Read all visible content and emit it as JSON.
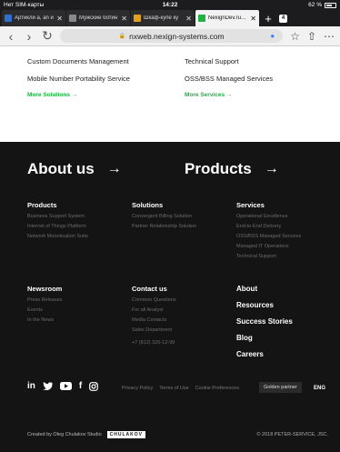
{
  "status": {
    "carrier": "Нет SIM-карты",
    "time": "14:22",
    "battery": "62 %",
    "battery_level": 0.62
  },
  "tabs": [
    {
      "label": "Артикли а, an и",
      "color": "#2f6fd0"
    },
    {
      "label": "Мужские ботин",
      "color": "#888888"
    },
    {
      "label": "Шкаф-купе ку",
      "color": "#e0a020"
    },
    {
      "label": "NexignDev.ru - Гл",
      "color": "#1fb141"
    }
  ],
  "tab_count": "4",
  "url": "nxweb.nexign-systems.com",
  "solutions_links": {
    "col1": [
      "Custom Documents Management",
      "Mobile Number Portability Service"
    ],
    "col2": [
      "Technical Support",
      "OSS/BSS Managed Services"
    ],
    "more_solutions": "More Solutions →",
    "more_services": "More Services →"
  },
  "footer": {
    "about_us": "About us",
    "products_big": "Products",
    "arrow": "→",
    "products": {
      "head": "Products",
      "items": [
        "Business Support System",
        "Internet of Things Platform",
        "Network Monetisation Suite"
      ]
    },
    "solutions": {
      "head": "Solutions",
      "items": [
        "Convergent Billing Solution",
        "Partner Relationship Solution"
      ]
    },
    "services": {
      "head": "Services",
      "items": [
        "Operational Excellence",
        "End-to-End Delivery",
        "OSS/BSS Managed Services",
        "Managed IT Operations",
        "Technical Support"
      ]
    },
    "newsroom": {
      "head": "Newsroom",
      "items": [
        "Press Releases",
        "Events",
        "In the News"
      ]
    },
    "contact": {
      "head": "Contact us",
      "items": [
        "Common Questions",
        "For all Analyst",
        "Media Contacts",
        "Sales Department",
        "+7 (812) 326-12-99"
      ]
    },
    "more": [
      "About",
      "Resources",
      "Success Stories",
      "Blog",
      "Careers"
    ],
    "social": [
      "in",
      "twitter",
      "youtube",
      "f",
      "instagram"
    ],
    "legal": [
      "Privacy Policy",
      "Terms of Use",
      "Cookie Preferences"
    ],
    "golden": "Golden partner",
    "lang": "ENG",
    "credit": "Created by Oleg Chulakov Studio",
    "credit_logo": "CHULAKOV",
    "copyright": "© 2018 PETER-SERVICE, JSC."
  }
}
